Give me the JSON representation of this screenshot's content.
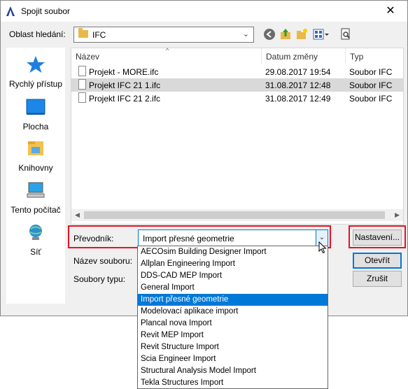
{
  "window": {
    "title": "Spojit soubor",
    "close": "✕"
  },
  "toolbar": {
    "look_in_label": "Oblast hledání:",
    "look_in_value": "IFC",
    "icons": [
      "back-icon",
      "up-folder-icon",
      "new-folder-icon",
      "view-menu-icon",
      "preview-icon"
    ]
  },
  "places": [
    {
      "label": "Rychlý přístup",
      "icon": "star-icon"
    },
    {
      "label": "Plocha",
      "icon": "desktop-icon"
    },
    {
      "label": "Knihovny",
      "icon": "libraries-icon"
    },
    {
      "label": "Tento počítač",
      "icon": "computer-icon"
    },
    {
      "label": "Síť",
      "icon": "network-icon"
    }
  ],
  "file_list": {
    "columns": [
      "Název",
      "Datum změny",
      "Typ"
    ],
    "rows": [
      {
        "name": "Projekt - MORE.ifc",
        "date": "29.08.2017 19:54",
        "type": "Soubor IFC",
        "selected": false
      },
      {
        "name": "Projekt IFC 21 1.ifc",
        "date": "31.08.2017 12:48",
        "type": "Soubor IFC",
        "selected": true
      },
      {
        "name": "Projekt IFC 21 2.ifc",
        "date": "31.08.2017 12:49",
        "type": "Soubor IFC",
        "selected": false
      }
    ]
  },
  "converter": {
    "label": "Převodník:",
    "value": "Import přesné geometrie"
  },
  "filename_label": "Název souboru:",
  "filetype_label": "Soubory typu:",
  "buttons": {
    "settings": "Nastavení...",
    "open": "Otevřít",
    "cancel": "Zrušit"
  },
  "dropdown_options": [
    "AECOsim Building Designer Import",
    "Allplan Engineering Import",
    "DDS-CAD MEP Import",
    "General Import",
    "Import přesné geometrie",
    "Modelovací aplikace import",
    "Plancal nova Import",
    "Revit MEP Import",
    "Revit Structure Import",
    "Scia Engineer Import",
    "Structural Analysis Model Import",
    "Tekla Structures Import"
  ],
  "highlighted_option_index": 4,
  "colors": {
    "accent": "#0078d7",
    "highlight_box": "#e81123",
    "selected_row": "#d9d9d9"
  }
}
